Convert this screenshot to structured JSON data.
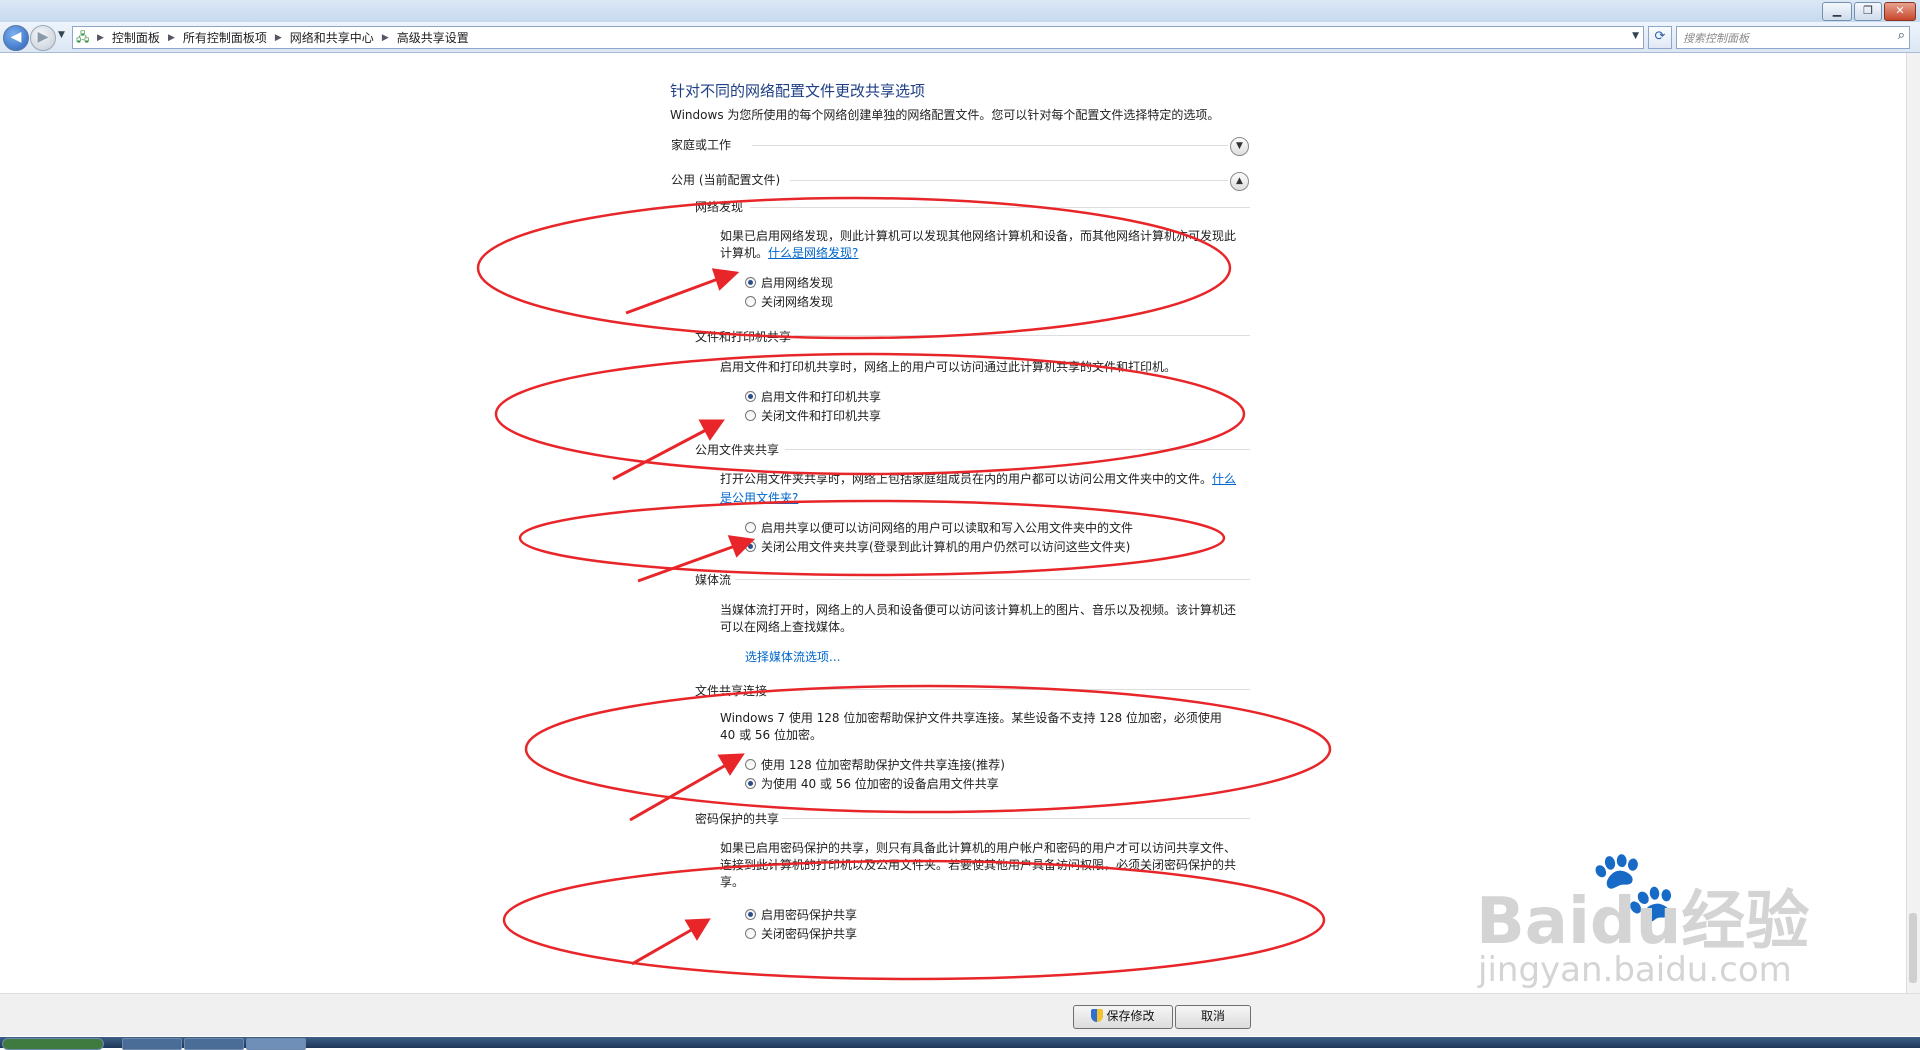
{
  "window": {
    "minimize_glyph": "▁",
    "maximize_glyph": "❐",
    "close_glyph": "✕"
  },
  "navigation": {
    "back_glyph": "◀",
    "forward_glyph": "▶",
    "breadcrumbs": [
      "控制面板",
      "所有控制面板项",
      "网络和共享中心",
      "高级共享设置"
    ],
    "search_placeholder": "搜索控制面板",
    "icons": [
      "back-arrow-icon",
      "forward-arrow-icon",
      "network-folder-icon",
      "refresh-icon",
      "search-icon"
    ]
  },
  "page": {
    "title": "针对不同的网络配置文件更改共享选项",
    "description": "Windows 为您所使用的每个网络创建单独的网络配置文件。您可以针对每个配置文件选择特定的选项。",
    "profiles": [
      {
        "label": "家庭或工作",
        "expanded": false
      },
      {
        "label": "公用 (当前配置文件)",
        "expanded": true
      }
    ]
  },
  "sections": {
    "network_discovery": {
      "title": "网络发现",
      "desc": "如果已启用网络发现，则此计算机可以发现其他网络计算机和设备，而其他网络计算机亦可发现此计算机。",
      "link": "什么是网络发现?",
      "options": [
        "启用网络发现",
        "关闭网络发现"
      ],
      "selected": 0
    },
    "file_printer": {
      "title": "文件和打印机共享",
      "desc": "启用文件和打印机共享时，网络上的用户可以访问通过此计算机共享的文件和打印机。",
      "options": [
        "启用文件和打印机共享",
        "关闭文件和打印机共享"
      ],
      "selected": 0
    },
    "public_folder": {
      "title": "公用文件夹共享",
      "desc": "打开公用文件夹共享时，网络上包括家庭组成员在内的用户都可以访问公用文件夹中的文件。",
      "link_part1": "什么",
      "link_part2": "是公用文件夹?",
      "options": [
        "启用共享以便可以访问网络的用户可以读取和写入公用文件夹中的文件",
        "关闭公用文件夹共享(登录到此计算机的用户仍然可以访问这些文件夹)"
      ],
      "selected": 1
    },
    "media_streaming": {
      "title": "媒体流",
      "desc": "当媒体流打开时，网络上的人员和设备便可以访问该计算机上的图片、音乐以及视频。该计算机还可以在网络上查找媒体。",
      "link": "选择媒体流选项..."
    },
    "file_sharing_conn": {
      "title": "文件共享连接",
      "desc": "Windows 7 使用 128 位加密帮助保护文件共享连接。某些设备不支持 128 位加密，必须使用 40 或 56 位加密。",
      "options": [
        "使用 128 位加密帮助保护文件共享连接(推荐)",
        "为使用 40 或 56 位加密的设备启用文件共享"
      ],
      "selected": 1
    },
    "password_sharing": {
      "title": "密码保护的共享",
      "desc": "如果已启用密码保护的共享，则只有具备此计算机的用户帐户和密码的用户才可以访问共享文件、连接到此计算机的打印机以及公用文件夹。若要使其他用户具备访问权限，必须关闭密码保护的共享。",
      "options": [
        "启用密码保护共享",
        "关闭密码保护共享"
      ],
      "selected": 0
    }
  },
  "footer": {
    "save_label": "保存修改",
    "cancel_label": "取消"
  },
  "watermark": {
    "brand": "Baidu",
    "brand_cn": "经验",
    "url": "jingyan.baidu.com"
  },
  "colors": {
    "annotation_red": "#e8262a",
    "heading_blue": "#1e3f86",
    "link_blue": "#0066cc"
  }
}
